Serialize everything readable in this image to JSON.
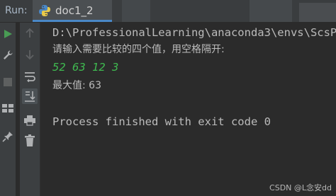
{
  "tab_bar": {
    "run_label": "Run:",
    "tab_title": "doc1_2",
    "close_glyph": "×"
  },
  "console": {
    "command_line": "D:\\ProfessionalLearning\\anaconda3\\envs\\ScsP",
    "prompt": "请输入需要比较的四个值，用空格隔开:",
    "user_input": "52 63 12 3",
    "result": "最大值: 63",
    "exit_message": "Process finished with exit code 0"
  },
  "colors": {
    "background": "#2b2b2b",
    "panel": "#3c3f41",
    "run_green": "#499c54",
    "input_green": "#3fb950",
    "tab_underline": "#4a88c7",
    "text": "#bbbbbb"
  },
  "icons": {
    "left_toolbar": [
      "run-icon",
      "wrench-icon",
      "stop-icon",
      "layout-icon",
      "pin-icon"
    ],
    "right_toolbar": [
      "arrow-up-icon",
      "arrow-down-icon",
      "soft-wrap-icon",
      "scroll-to-end-icon",
      "print-icon",
      "trash-icon"
    ]
  },
  "watermark": "CSDN @L念安dd"
}
